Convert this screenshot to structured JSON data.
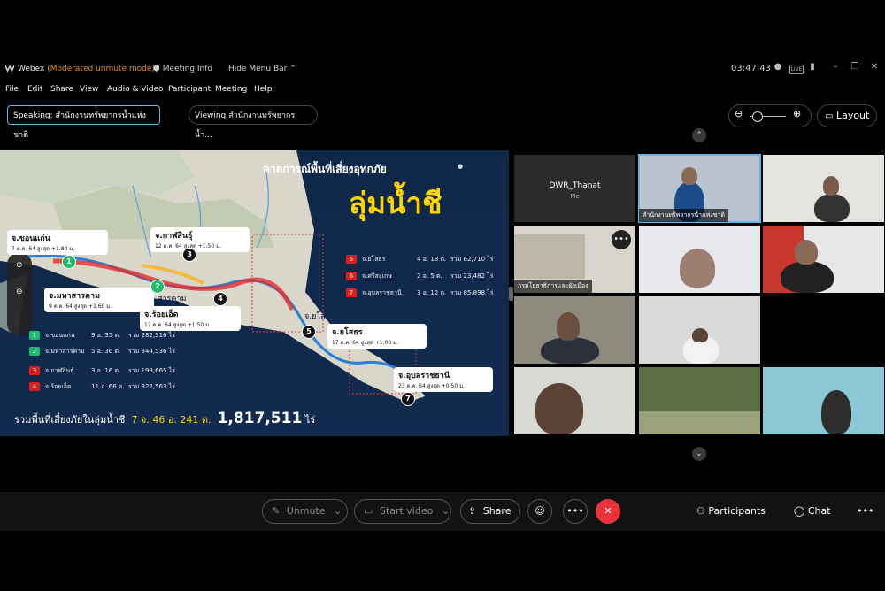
{
  "window": {
    "app_name": "Webex",
    "mode": "(Moderated unmute mode)",
    "meeting_info": "Meeting Info",
    "hide_menu": "Hide Menu Bar",
    "clock": "03:47:43"
  },
  "menu": [
    "File",
    "Edit",
    "Share",
    "View",
    "Audio & Video",
    "Participant",
    "Meeting",
    "Help"
  ],
  "speaking": "Speaking: สำนักงานทรัพยากรน้ำแห่งชาติ",
  "viewing": "Viewing สำนักงานทรัพยากรน้ำ...",
  "layout_label": "Layout",
  "share": {
    "title": "คาดการณ์พื้นที่เสี่ยงอุทกภัย",
    "basin": "ลุ่มน้ำชี",
    "callouts": [
      {
        "name": "จ.ขอนแก่น",
        "detail": "7 ต.ค. 64 สูงสุด +1.80 ม."
      },
      {
        "name": "จ.กาฬสินธุ์",
        "detail": "12 ต.ค. 64 สูงสุด +1.50 ม."
      },
      {
        "name": "จ.มหาสารคาม",
        "detail": "9 ต.ค. 64 สูงสุด +1.60 ม."
      },
      {
        "name": "จ.ร้อยเอ็ด",
        "detail": "12 ต.ค. 64 สูงสุด +1.50 ม."
      },
      {
        "name": "จ.ยโสธร",
        "detail": "17 ต.ค. 64 สูงสุด +1.00 ม."
      },
      {
        "name": "จ.อุบลราชธานี",
        "detail": "23 ต.ค. 64 สูงสุด +0.50 ม."
      }
    ],
    "map_labels": [
      "สารคาม",
      "จ.ยโส"
    ],
    "markers": [
      "1",
      "2",
      "3",
      "4",
      "5",
      "6",
      "7"
    ],
    "stats_left": [
      {
        "n": "1",
        "prov": "จ.ขอนแก่น",
        "amt": "9 อ. 35 ต.",
        "sum": "รวม 282,316 ไร่"
      },
      {
        "n": "2",
        "prov": "จ.มหาสารคาม",
        "amt": "5 อ. 36 ต.",
        "sum": "รวม 344,536 ไร่"
      },
      {
        "n": "3",
        "prov": "จ.กาฬสินธุ์",
        "amt": "3 อ. 16 ต.",
        "sum": "รวม 199,665 ไร่"
      },
      {
        "n": "4",
        "prov": "จ.ร้อยเอ็ด",
        "amt": "11 อ. 66 ต.",
        "sum": "รวม 322,563 ไร่"
      }
    ],
    "stats_right": [
      {
        "n": "5",
        "prov": "จ.ยโสธร",
        "amt": "4 อ. 18 ต.",
        "sum": "รวม 62,710 ไร่"
      },
      {
        "n": "6",
        "prov": "จ.ศรีสะเกษ",
        "amt": "2 อ. 5 ต.",
        "sum": "รวม 23,482 ไร่"
      },
      {
        "n": "7",
        "prov": "จ.อุบลราชธานี",
        "amt": "3 อ. 12 ต.",
        "sum": "รวม 85,898 ไร่"
      }
    ],
    "total_label": "รวมพื้นที่เสี่ยงภัยในลุ่มน้ำชี",
    "total_count": "7 จ. 46 อ. 241 ต.",
    "total_value": "1,817,511",
    "total_unit": "ไร่"
  },
  "gallery": {
    "me_name": "DWR_Thanat",
    "me_sub": "Me",
    "tile_labels": [
      "สำนักงานทรัพยากรน้ำแห่งชาติ",
      "กรมโยธาธิการและผังเมือง"
    ]
  },
  "controls": {
    "unmute": "Unmute",
    "start_video": "Start video",
    "share": "Share",
    "participants": "Participants",
    "chat": "Chat"
  },
  "colors": {
    "accent": "#5fb8e8",
    "end": "#e5353a",
    "mode": "#d8901a",
    "basin": "#ffd400"
  }
}
